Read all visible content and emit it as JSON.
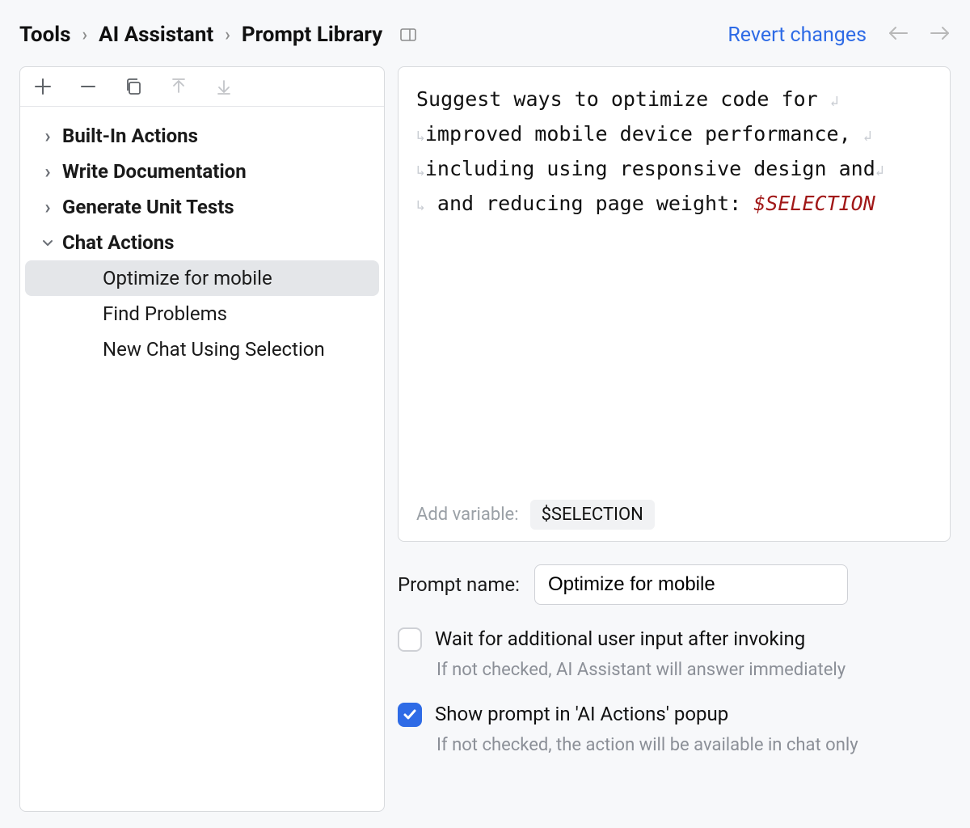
{
  "header": {
    "breadcrumb": [
      "Tools",
      "AI Assistant",
      "Prompt Library"
    ],
    "revert": "Revert changes"
  },
  "sidebar": {
    "groups": [
      {
        "label": "Built-In Actions",
        "expanded": false
      },
      {
        "label": "Write Documentation",
        "expanded": false
      },
      {
        "label": "Generate Unit Tests",
        "expanded": false
      },
      {
        "label": "Chat Actions",
        "expanded": true,
        "children": [
          {
            "label": "Optimize for mobile",
            "selected": true
          },
          {
            "label": "Find Problems",
            "selected": false
          },
          {
            "label": "New Chat Using Selection",
            "selected": false
          }
        ]
      }
    ]
  },
  "editor": {
    "text_pre": "Suggest ways to optimize code for improved mobile device performance, including using responsive design and  and reducing page weight: ",
    "variable": "$SELECTION",
    "add_variable_label": "Add variable:",
    "variable_chip": "$SELECTION"
  },
  "form": {
    "prompt_name_label": "Prompt name:",
    "prompt_name_value": "Optimize for mobile",
    "wait_checkbox": {
      "label": "Wait for additional user input after invoking",
      "help": "If not checked, AI Assistant will answer immediately",
      "checked": false
    },
    "show_checkbox": {
      "label": "Show prompt in 'AI Actions' popup",
      "help": "If not checked, the action will be available in chat only",
      "checked": true
    }
  }
}
